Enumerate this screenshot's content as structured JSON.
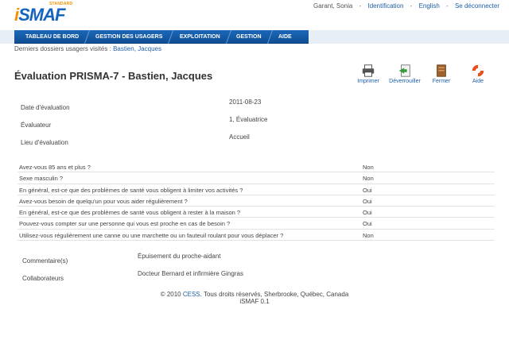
{
  "logo": {
    "standard": "STANDARD",
    "name_i": "i",
    "name_rest": "SMAF"
  },
  "toplinks": {
    "user": "Garant, Sonia",
    "identification": "Identification",
    "english": "English",
    "logout": "Se déconnecter",
    "separator": "-"
  },
  "nav": {
    "items": [
      {
        "label": "TABLEAU DE BORD"
      },
      {
        "label": "GESTION DES USAGERS"
      },
      {
        "label": "EXPLOITATION"
      },
      {
        "label": "GESTION"
      },
      {
        "label": "AIDE"
      }
    ]
  },
  "breadcrumb": {
    "prefix": "Derniers dossiers usagers visités :",
    "link": "Bastien, Jacques"
  },
  "page": {
    "title": "Évaluation PRISMA-7 - Bastien, Jacques"
  },
  "toolbar": {
    "print": "Imprimer",
    "unlock": "Déverrouiller",
    "close": "Fermer",
    "help": "Aide"
  },
  "meta": {
    "date_label": "Date d'évaluation",
    "date_value": "2011-08-23",
    "evaluator_label": "Évaluateur",
    "evaluator_value": "1, Évaluatrice",
    "place_label": "Lieu d'évaluation",
    "place_value": "Accueil"
  },
  "questions": [
    {
      "q": "Avez-vous 85 ans et plus ?",
      "a": "Non"
    },
    {
      "q": "Sexe masculin ?",
      "a": "Non"
    },
    {
      "q": "En général, est-ce que des problèmes de santé vous obligent à limiter vos activités ?",
      "a": "Oui"
    },
    {
      "q": "Avez-vous besoin de quelqu'un pour vous aider régulièrement ?",
      "a": "Oui"
    },
    {
      "q": "En général, est-ce que des problèmes de santé vous obligent à rester à la maison ?",
      "a": "Oui"
    },
    {
      "q": "Pouvez-vous compter sur une personne qui vous est proche en cas de besoin ?",
      "a": "Oui"
    },
    {
      "q": "Utilisez-vous régulièrement une canne ou une marchette ou un fauteuil roulant pour vous déplacer ?",
      "a": "Non"
    }
  ],
  "comments": {
    "comment_label": "Commentaire(s)",
    "comment_value": "Épuisement du proche-aidant",
    "collab_label": "Collaborateurs",
    "collab_value": "Docteur Bernard et infirmière Gingras"
  },
  "footer": {
    "prefix": "© 2010",
    "link": "CESS",
    "suffix": ". Tous droits réservés, Sherbrooke, Québec, Canada",
    "version": "iSMAF 0.1"
  },
  "colors": {
    "brand_blue": "#1565c0",
    "brand_orange": "#f39200",
    "nav_blue": "#1b67b8",
    "link": "#1f5fa8"
  }
}
